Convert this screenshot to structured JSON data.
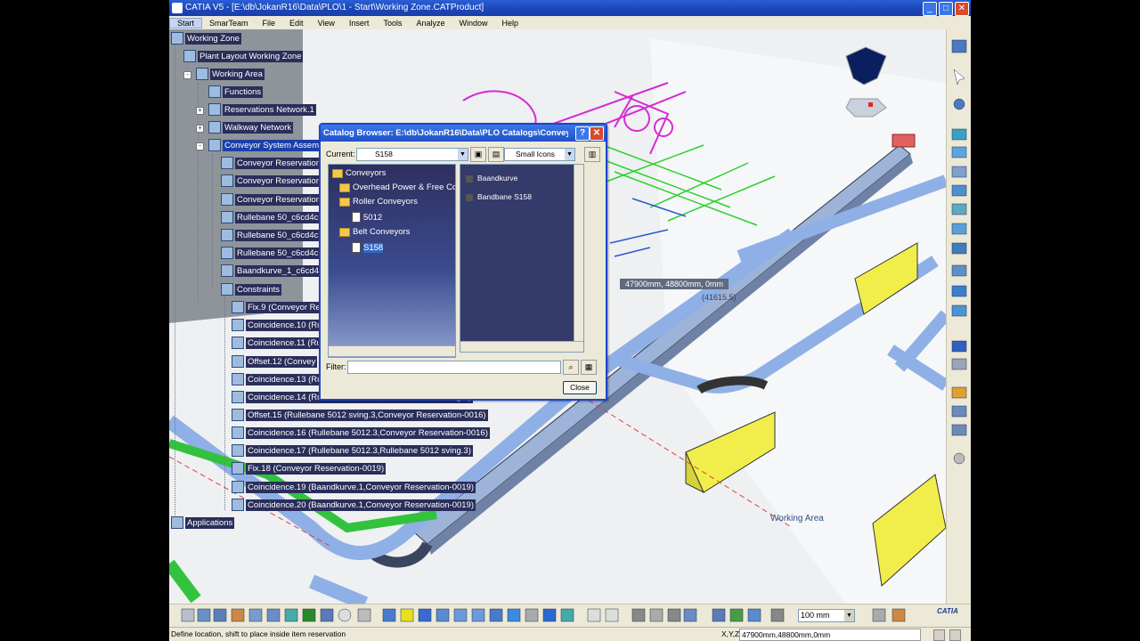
{
  "window": {
    "title": "CATIA V5 - [E:\\db\\JokanR16\\Data\\PLO\\1 - Start\\Working Zone.CATProduct]"
  },
  "menu": [
    "Start",
    "SmarTeam",
    "File",
    "Edit",
    "View",
    "Insert",
    "Tools",
    "Analyze",
    "Window",
    "Help"
  ],
  "tree": {
    "root": "Working Zone",
    "plant": "Plant Layout Working Zone",
    "area": "Working Area",
    "functions": "Functions",
    "reservations": "Reservations Network.1",
    "walkway": "Walkway Network",
    "conveyor_assem": "Conveyor System Assem",
    "items": [
      "Conveyor Reservation",
      "Conveyor Reservation",
      "Conveyor Reservation",
      "Rullebane 50_c6cd4c3",
      "Rullebane 50_c6cd4c3",
      "Rullebane 50_c6cd4c3",
      "Baandkurve_1_c6cd4"
    ],
    "constraints": "Constraints",
    "constraint_items": [
      "Fix.9 (Conveyor Rese",
      "Coincidence.10 (Ru",
      "Coincidence.11 (Ru",
      "Offset.12 (Convey",
      "Coincidence.13 (Rullebane 5012.2,Conveyor Reservation-0016)",
      "Coincidence.14 (Rullebane 5012.2,Rullebane 5012 sving.3)",
      "Offset.15 (Rullebane 5012 sving.3,Conveyor Reservation-0016)",
      "Coincidence.16 (Rullebane 5012.3,Conveyor Reservation-0016)",
      "Coincidence.17 (Rullebane 5012.3,Rullebane 5012 sving.3)",
      "Fix.18 (Conveyor Reservation-0019)",
      "Coincidence.19 (Baandkurve.1,Conveyor Reservation-0019)",
      "Coincidence.20 (Baandkurve.1,Conveyor Reservation-0019)"
    ],
    "applications": "Applications"
  },
  "dialog": {
    "title": "Catalog Browser: E:\\db\\JokanR16\\Data\\PLO Catalogs\\Conveyo...",
    "help_label": "?",
    "close_x": "✕",
    "current_label": "Current:",
    "current_value": "S158",
    "view_value": "Small Icons",
    "tree_items": [
      "Conveyors",
      "Overhead Power & Free Co",
      "Roller Conveyors",
      "5012",
      "Belt Conveyors",
      "S158"
    ],
    "list_items": [
      "Baandkurve",
      "Bandbane S158"
    ],
    "filter_label": "Filter:",
    "filter_value": "",
    "close_button": "Close"
  },
  "viewport": {
    "coord_tooltip": "47900mm, 48800mm, 0mm",
    "coord_tooltip2": "(41615.5)",
    "working_area_label": "Working Area"
  },
  "toolbar": {
    "zoom_value": "100 mm",
    "logo": "CATIA"
  },
  "status": {
    "message": "Define location, shift to place inside item reservation",
    "xyz_label": "X,Y,Z",
    "xyz_value": "47900mm,48800mm,0mm"
  }
}
